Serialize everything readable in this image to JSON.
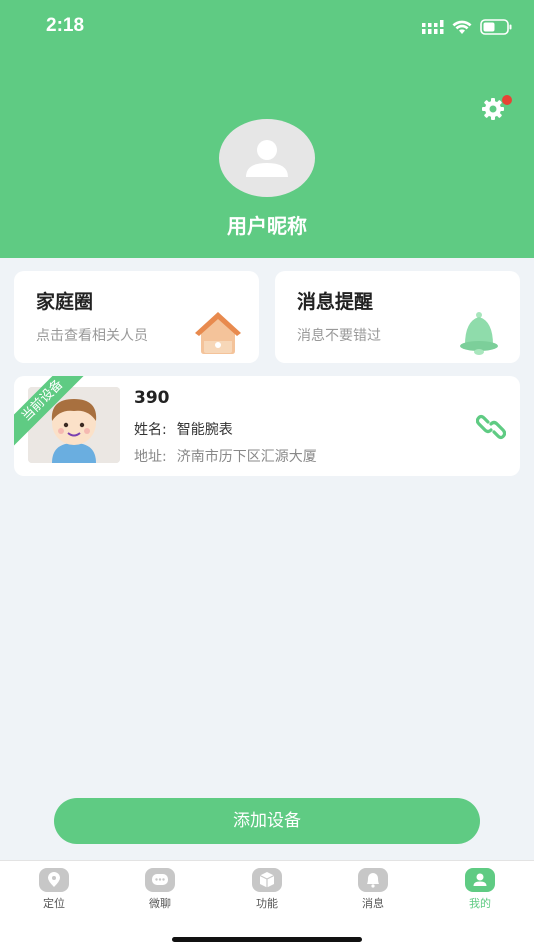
{
  "status_bar": {
    "time": "2:18"
  },
  "header": {
    "nickname": "用户昵称"
  },
  "cards": {
    "family": {
      "title": "家庭圈",
      "subtitle": "点击查看相关人员"
    },
    "messages": {
      "title": "消息提醒",
      "subtitle": "消息不要错过"
    }
  },
  "device": {
    "badge": "当前设备",
    "id": "390",
    "name_label": "姓名:",
    "name_value": "智能腕表",
    "address_label": "地址:",
    "address_value": "济南市历下区汇源大厦"
  },
  "add_button": "添加设备",
  "tabs": [
    {
      "label": "定位",
      "icon": "location-icon"
    },
    {
      "label": "微聊",
      "icon": "chat-icon"
    },
    {
      "label": "功能",
      "icon": "box-icon"
    },
    {
      "label": "消息",
      "icon": "bell-icon"
    },
    {
      "label": "我的",
      "icon": "person-icon",
      "active": true
    }
  ],
  "colors": {
    "accent": "#5fcb83",
    "background": "#eff3f7",
    "notification": "#e84335"
  }
}
